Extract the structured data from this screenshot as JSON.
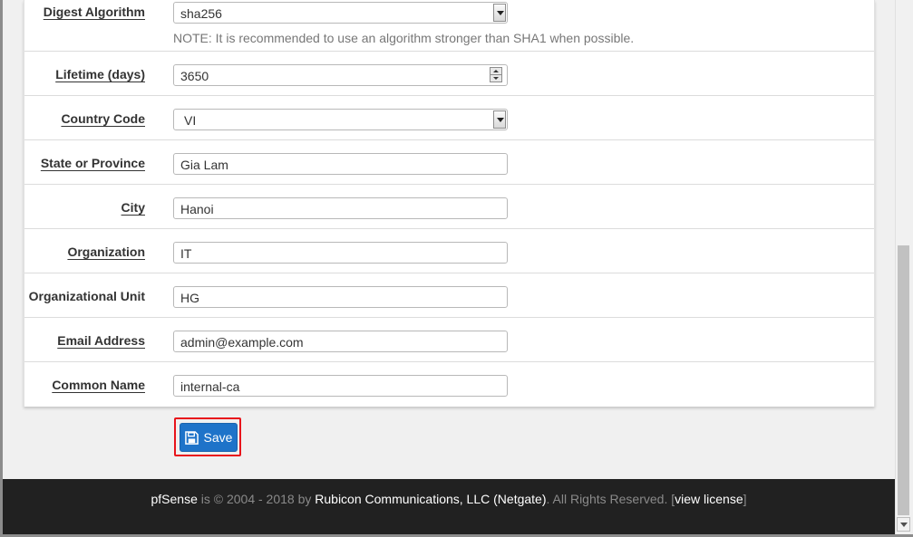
{
  "form": {
    "digest": {
      "label": "Digest Algorithm",
      "value": "sha256",
      "note": "NOTE: It is recommended to use an algorithm stronger than SHA1 when possible."
    },
    "lifetime": {
      "label": "Lifetime (days)",
      "value": "3650"
    },
    "country": {
      "label": "Country Code",
      "value": "VI"
    },
    "state": {
      "label": "State or Province",
      "value": "Gia Lam"
    },
    "city": {
      "label": "City",
      "value": "Hanoi"
    },
    "organization": {
      "label": "Organization",
      "value": "IT"
    },
    "org_unit": {
      "label": "Organizational Unit",
      "value": "HG"
    },
    "email": {
      "label": "Email Address",
      "value": "admin@example.com"
    },
    "common_name": {
      "label": "Common Name",
      "value": "internal-ca"
    }
  },
  "actions": {
    "save_label": "Save"
  },
  "footer": {
    "brand": "pfSense",
    "copyright": " is © 2004 - 2018 by ",
    "company": "Rubicon Communications, LLC (Netgate)",
    "rights": ". All Rights Reserved. [",
    "license_link": "view license",
    "close_bracket": "]"
  },
  "colors": {
    "accent": "#1e73c9",
    "highlight": "#e8141b",
    "footer_bg": "#212121"
  }
}
